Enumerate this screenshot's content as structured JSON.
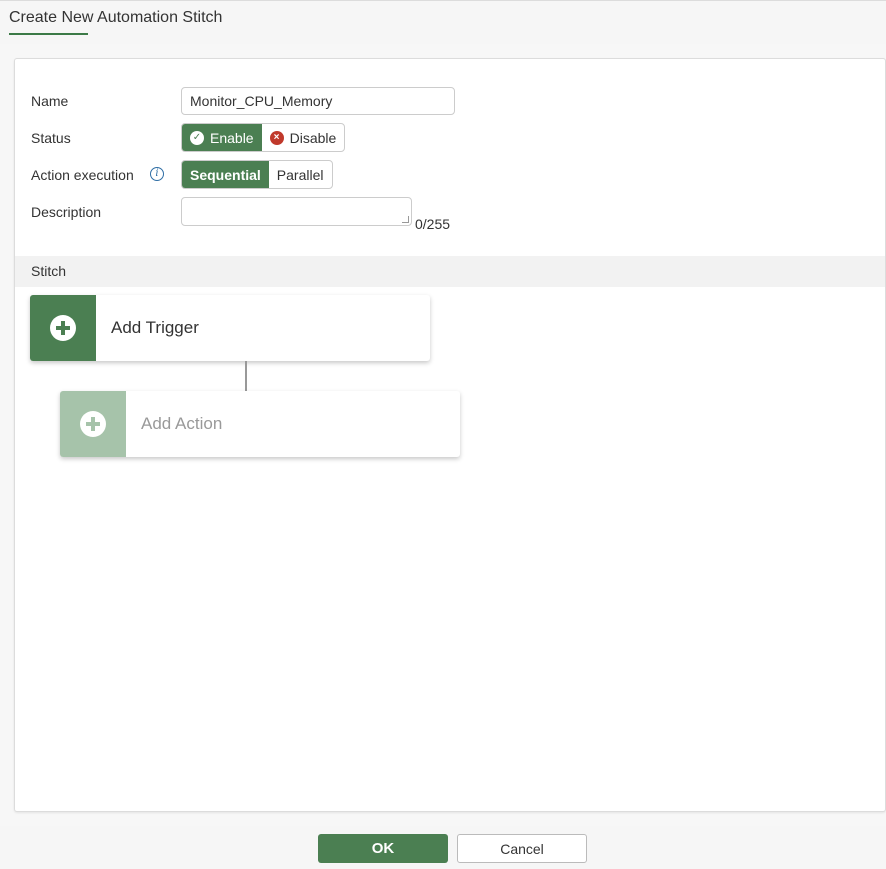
{
  "dialog": {
    "title": "Create New Automation Stitch"
  },
  "form": {
    "name": {
      "label": "Name",
      "value": "Monitor_CPU_Memory"
    },
    "status": {
      "label": "Status",
      "options": [
        {
          "label": "Enable",
          "icon": "check-circle-icon",
          "selected": true
        },
        {
          "label": "Disable",
          "icon": "x-circle-icon",
          "selected": false
        }
      ]
    },
    "action_execution": {
      "label": "Action execution",
      "info_icon": "info-icon",
      "options": [
        {
          "label": "Sequential",
          "selected": true
        },
        {
          "label": "Parallel",
          "selected": false
        }
      ]
    },
    "description": {
      "label": "Description",
      "value": "",
      "counter": "0/255"
    }
  },
  "stitch": {
    "section_title": "Stitch",
    "trigger": {
      "label": "Add Trigger",
      "icon": "plus-circle-icon"
    },
    "action": {
      "label": "Add Action",
      "icon": "plus-circle-icon",
      "enabled": false
    }
  },
  "footer": {
    "ok_label": "OK",
    "cancel_label": "Cancel"
  },
  "colors": {
    "accent": "#4b7f52",
    "accent_disabled": "#a6c3aa",
    "underline": "#3c7a47",
    "error": "#c0392b",
    "info": "#2f6ea5"
  }
}
